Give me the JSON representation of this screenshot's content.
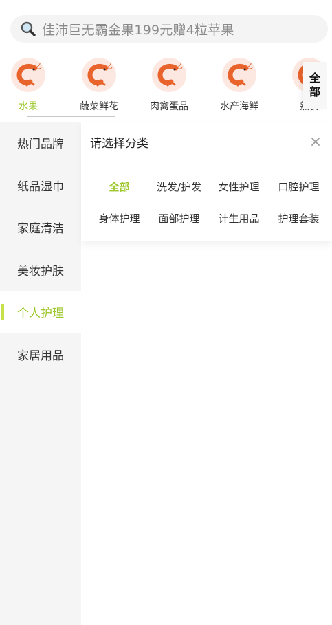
{
  "search": {
    "placeholder": "佳沛巨无霸金果199元赠4粒苹果"
  },
  "categories": [
    {
      "label": "水果",
      "icon": "shrimp-icon",
      "active": true
    },
    {
      "label": "蔬菜鲜花",
      "icon": "shrimp-icon"
    },
    {
      "label": "肉禽蛋品",
      "icon": "shrimp-icon"
    },
    {
      "label": "水产海鲜",
      "icon": "shrimp-icon"
    },
    {
      "label": "熟食",
      "icon": "shrimp-icon"
    }
  ],
  "all_button": {
    "line1": "全",
    "line2": "部"
  },
  "sidebar": {
    "items": [
      {
        "label": "热门品牌"
      },
      {
        "label": "纸品湿巾"
      },
      {
        "label": "家庭清洁"
      },
      {
        "label": "美妆护肤"
      },
      {
        "label": "个人护理",
        "active": true
      },
      {
        "label": "家居用品"
      }
    ]
  },
  "panel": {
    "title": "请选择分类",
    "chips": [
      {
        "label": "全部",
        "active": true
      },
      {
        "label": "洗发/护发"
      },
      {
        "label": "女性护理"
      },
      {
        "label": "口腔护理"
      },
      {
        "label": "身体护理"
      },
      {
        "label": "面部护理"
      },
      {
        "label": "计生用品"
      },
      {
        "label": "护理套装"
      }
    ]
  },
  "colors": {
    "accent": "#9cc62a",
    "sidebar_bg": "#f5f5f5"
  }
}
